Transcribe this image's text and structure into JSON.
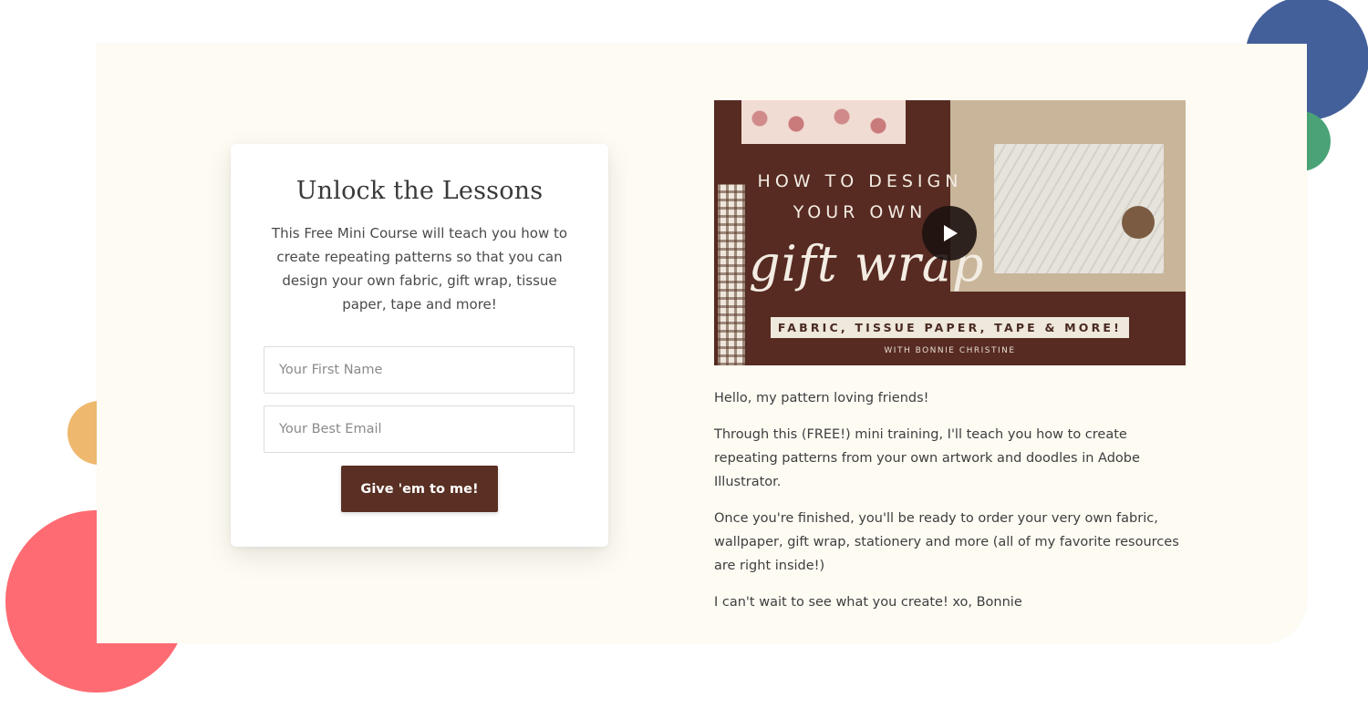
{
  "colors": {
    "panel_background": "#fefbf3",
    "button_background": "#5a3024",
    "video_background": "#572b22",
    "deco_blue": "#44609a",
    "deco_green": "#4aa376",
    "deco_orange": "#eeb96e",
    "deco_red": "#ff6b72"
  },
  "optin": {
    "title": "Unlock the Lessons",
    "description": "This Free Mini Course will teach you how to create repeating patterns so that you can design your own fabric, gift wrap, tissue paper, tape and more!",
    "first_name_placeholder": "Your First Name",
    "email_placeholder": "Your Best Email",
    "submit_label": "Give 'em to me!"
  },
  "video": {
    "title_line": "HOW TO DESIGN\nYOUR OWN",
    "script_line": "gift wrap",
    "banner": "FABRIC, TISSUE PAPER, TAPE & MORE!",
    "byline": "WITH BONNIE CHRISTINE",
    "play_icon": "play-icon"
  },
  "body": {
    "paragraphs": [
      "Hello, my pattern loving friends!",
      "Through this (FREE!) mini training, I'll teach you how to create repeating patterns from your own artwork and doodles in Adobe Illustrator.",
      "Once you're finished, you'll be ready to order your very own fabric, wallpaper, gift wrap, stationery and more (all of my favorite resources are right inside!)",
      "I can't wait to see what you create! xo, Bonnie"
    ]
  }
}
